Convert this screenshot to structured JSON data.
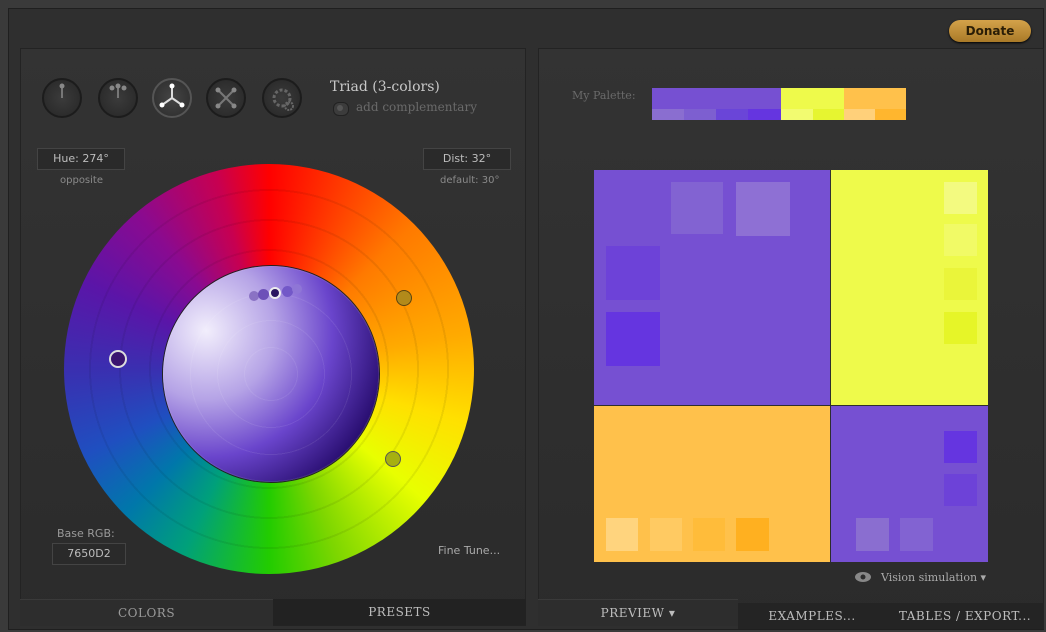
{
  "donate_label": "Donate",
  "scheme": {
    "title": "Triad (3-colors)",
    "complementary_label": "add complementary",
    "icons": [
      "mono-scheme-icon",
      "complement-scheme-icon",
      "triad-scheme-icon",
      "tetrad-scheme-icon",
      "analogic-scheme-icon"
    ]
  },
  "hue": {
    "label": "Hue: 274°",
    "sub": "opposite"
  },
  "dist": {
    "label": "Dist: 32°",
    "sub": "default: 30°"
  },
  "base": {
    "label": "Base RGB:",
    "value": "7650D2"
  },
  "fine_tune": "Fine Tune...",
  "left_tabs": {
    "colors": "COLORS",
    "presets": "PRESETS"
  },
  "right_tabs": {
    "preview": "PREVIEW ▾",
    "examples": "EXAMPLES...",
    "tables": "TABLES / EXPORT..."
  },
  "palette_label": "My Palette:",
  "vision_label": "Vision simulation ▾",
  "colors": {
    "primary": "#7650D2",
    "secondary_a": "#EEFA4B",
    "secondary_b": "#FFC14B",
    "primary_dark": "#6A35DE",
    "primary_light": "#8A6ED0",
    "accent": "#C89A3C"
  }
}
